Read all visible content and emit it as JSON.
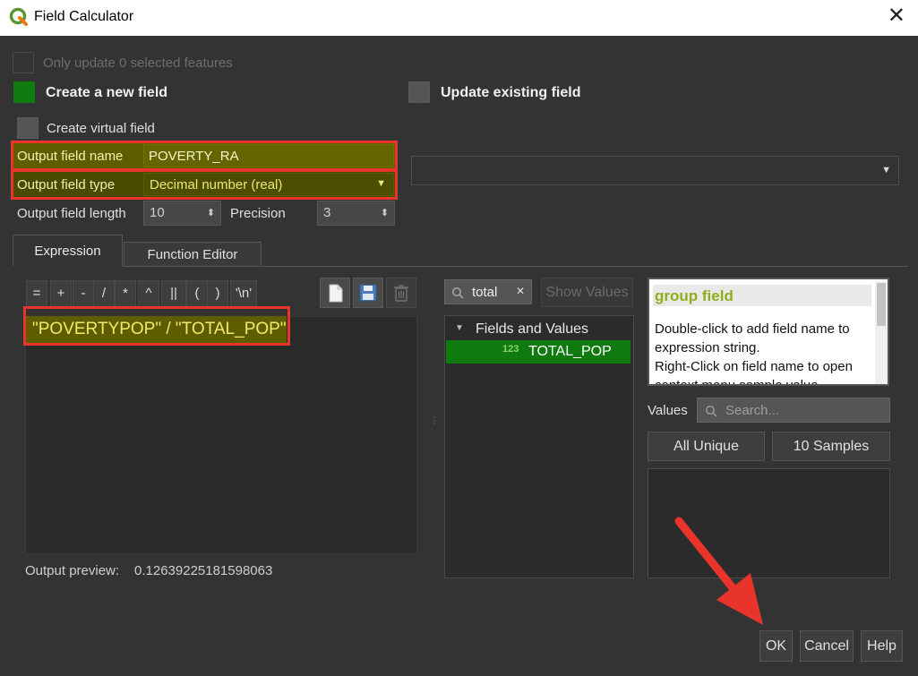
{
  "window": {
    "title": "Field Calculator"
  },
  "top": {
    "only_update": "Only update 0 selected features",
    "create_new": "Create a new field",
    "update_existing": "Update existing field",
    "create_virtual": "Create virtual field"
  },
  "output": {
    "name_label": "Output field name",
    "name_value": "POVERTY_RA",
    "type_label": "Output field type",
    "type_value": "Decimal number (real)",
    "length_label": "Output field length",
    "length_value": "10",
    "precision_label": "Precision",
    "precision_value": "3"
  },
  "tabs": {
    "expression": "Expression",
    "function_editor": "Function Editor"
  },
  "operators": [
    "=",
    "+",
    "-",
    "/",
    "*",
    "^",
    "||",
    "(",
    ")",
    "'\\n'"
  ],
  "expression": {
    "text": "\"POVERTYPOP\" / \"TOTAL_POP\"",
    "preview_label": "Output preview:",
    "preview_value": "0.12639225181598063"
  },
  "search": {
    "value": "total",
    "show_values": "Show Values"
  },
  "tree": {
    "group": "Fields and Values",
    "item_type": "123",
    "item": "TOTAL_POP"
  },
  "help": {
    "title": "group field",
    "line1": "Double-click to add field name to",
    "line2": "expression string.",
    "line3": "Right-Click on field name to open",
    "line4": "context menu sample value"
  },
  "values": {
    "label": "Values",
    "search_placeholder": "Search...",
    "all_unique": "All Unique",
    "samples": "10 Samples"
  },
  "buttons": {
    "ok": "OK",
    "cancel": "Cancel",
    "help": "Help"
  },
  "colors": {
    "accent_green": "#0f7b0f",
    "olive": "#5e5e00",
    "highlight_red": "#e8342a",
    "help_title": "#8fae1b"
  }
}
